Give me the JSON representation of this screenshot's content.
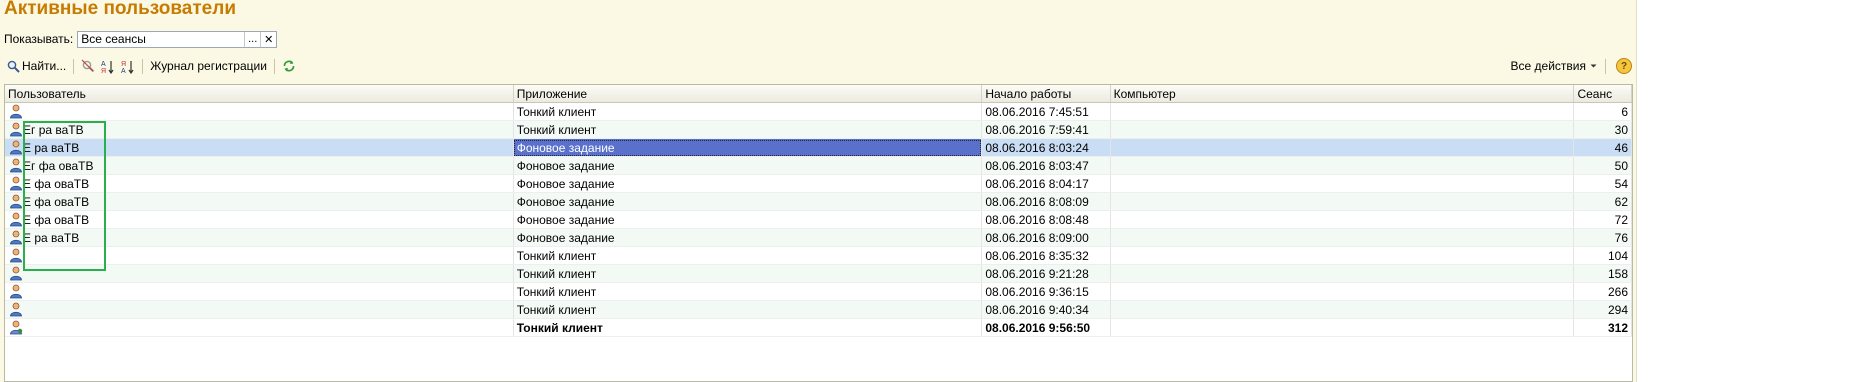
{
  "title": "Активные пользователи",
  "filter": {
    "label": "Показывать:",
    "value": "Все сеансы",
    "choose_glyph": "...",
    "clear_glyph": "✕"
  },
  "toolbar": {
    "find_label": "Найти...",
    "journal_label": "Журнал регистрации",
    "all_actions_label": "Все действия",
    "help_glyph": "?"
  },
  "table": {
    "columns": [
      "Пользователь",
      "Приложение",
      "Начало работы",
      "Компьютер",
      "Сеанс"
    ],
    "rows": [
      {
        "user": "",
        "app": "Тонкий клиент",
        "start": "08.06.2016 7:45:51",
        "computer": "",
        "session": "6"
      },
      {
        "user": "Ег ра ваТВ",
        "app": "Тонкий клиент",
        "start": "08.06.2016 7:59:41",
        "computer": "",
        "session": "30"
      },
      {
        "user": "Е ра ваТВ",
        "app": "Фоновое задание",
        "start": "08.06.2016 8:03:24",
        "computer": "",
        "session": "46"
      },
      {
        "user": "Ег фа оваТВ",
        "app": "Фоновое задание",
        "start": "08.06.2016 8:03:47",
        "computer": "",
        "session": "50"
      },
      {
        "user": "Е фа оваТВ",
        "app": "Фоновое задание",
        "start": "08.06.2016 8:04:17",
        "computer": "",
        "session": "54"
      },
      {
        "user": "Е фа оваТВ",
        "app": "Фоновое задание",
        "start": "08.06.2016 8:08:09",
        "computer": "",
        "session": "62"
      },
      {
        "user": "Е фа оваТВ",
        "app": "Фоновое задание",
        "start": "08.06.2016 8:08:48",
        "computer": "",
        "session": "72"
      },
      {
        "user": "Е ра ваТВ",
        "app": "Фоновое задание",
        "start": "08.06.2016 8:09:00",
        "computer": "",
        "session": "76"
      },
      {
        "user": "",
        "app": "Тонкий клиент",
        "start": "08.06.2016 8:35:32",
        "computer": "",
        "session": "104"
      },
      {
        "user": "",
        "app": "Тонкий клиент",
        "start": "08.06.2016 9:21:28",
        "computer": "",
        "session": "158"
      },
      {
        "user": "",
        "app": "Тонкий клиент",
        "start": "08.06.2016 9:36:15",
        "computer": "",
        "session": "266"
      },
      {
        "user": "",
        "app": "Тонкий клиент",
        "start": "08.06.2016 9:40:34",
        "computer": "",
        "session": "294"
      },
      {
        "user": "",
        "app": "Тонкий клиент",
        "start": "08.06.2016 9:56:50",
        "computer": "",
        "session": "312"
      }
    ],
    "selected_row": 2,
    "current_user_row": 12
  },
  "colors": {
    "title": "#c77b00",
    "selection": "#5a71cc",
    "highlight_box": "#2ab04a"
  }
}
